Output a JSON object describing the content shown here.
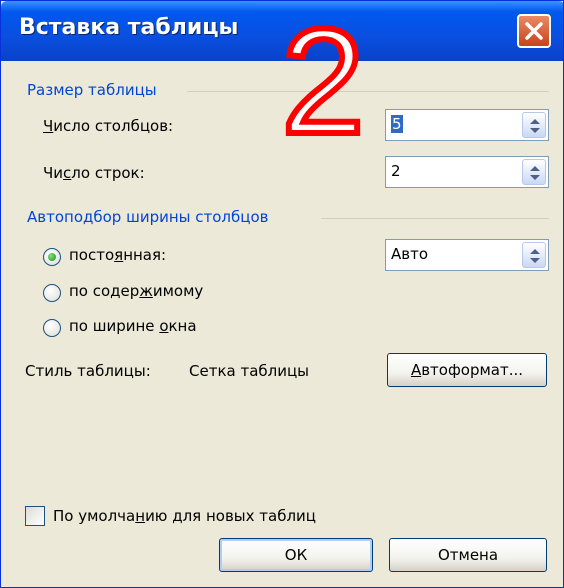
{
  "window": {
    "title": "Вставка таблицы"
  },
  "overlay": {
    "text": "2"
  },
  "size_group": {
    "title": "Размер таблицы",
    "columns": {
      "label_u": "Ч",
      "label_rest": "исло столбцов:",
      "value": "5"
    },
    "rows": {
      "label_a": "Чи",
      "label_u": "с",
      "label_b": "ло строк:",
      "value": "2"
    }
  },
  "autofit_group": {
    "title": "Автоподбор ширины столбцов",
    "fixed": {
      "label_a": "посто",
      "label_u": "я",
      "label_b": "нная:",
      "selected": true,
      "value": "Авто"
    },
    "content": {
      "label_a": "по содер",
      "label_u": "ж",
      "label_b": "имому",
      "selected": false
    },
    "window": {
      "label_a": "по ширине ",
      "label_u": "о",
      "label_b": "кна",
      "selected": false
    }
  },
  "style": {
    "label": "Стиль таблицы:",
    "value": "Сетка таблицы",
    "button_u": "А",
    "button_rest": "втоформат..."
  },
  "default_checkbox": {
    "label_a": "По умолча",
    "label_u": "н",
    "label_b": "ию для новых таблиц",
    "checked": false
  },
  "buttons": {
    "ok": "ОК",
    "cancel": "Отмена"
  },
  "colors": {
    "titlebar": "#0058ee",
    "group_title": "#0046d5",
    "dialog_bg": "#ece9d8",
    "overlay_red": "#ff0000"
  }
}
